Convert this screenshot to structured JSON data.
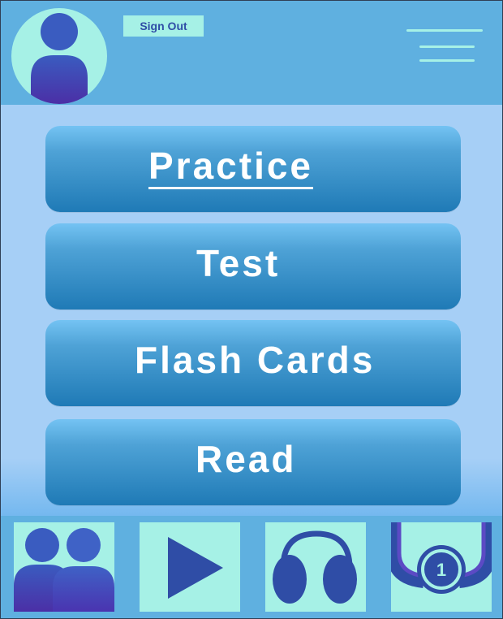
{
  "header": {
    "sign_out_label": "Sign Out",
    "avatar_icon": "user-avatar-icon",
    "menu_icon": "hamburger-menu-icon"
  },
  "menu_buttons": [
    {
      "label": "Practice",
      "underlined": true
    },
    {
      "label": "Test"
    },
    {
      "label": "Flash Cards"
    },
    {
      "label": "Read"
    }
  ],
  "bottom_nav": [
    {
      "icon": "users-icon"
    },
    {
      "icon": "play-icon"
    },
    {
      "icon": "headphones-icon"
    },
    {
      "icon": "medal-icon",
      "badge": "1"
    }
  ],
  "colors": {
    "header_bg": "#5fb0e0",
    "page_bg": "#a6cff6",
    "mint": "#a6f1e6",
    "icon_blue": "#2f4da6",
    "icon_purple": "#4b2fa6",
    "button_top": "#74c3f3",
    "button_bottom": "#1f7ab6"
  }
}
